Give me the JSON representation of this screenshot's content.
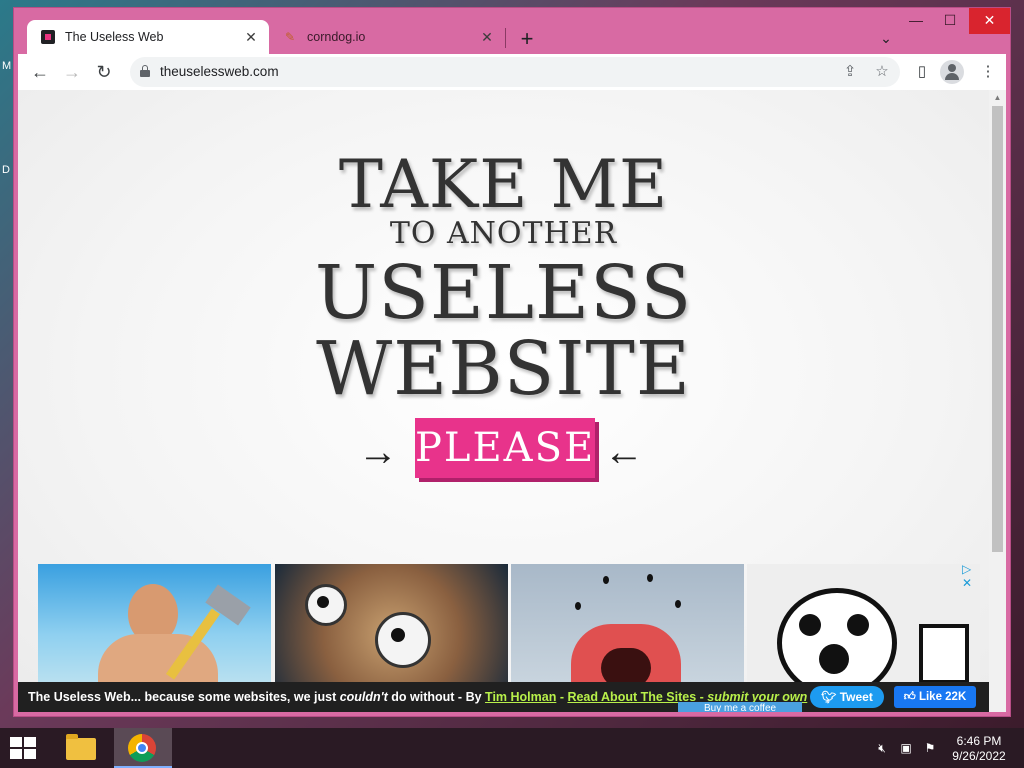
{
  "browser": {
    "tabs": [
      {
        "title": "The Useless Web",
        "active": true
      },
      {
        "title": "corndog.io",
        "active": false
      }
    ],
    "address": "theuselessweb.com",
    "window_controls": {
      "minimize": "—",
      "maximize": "☐",
      "close": "✕"
    }
  },
  "page": {
    "headline": {
      "line1": "TAKE ME",
      "line2": "TO ANOTHER",
      "line3": "USELESS",
      "line4": "WEBSITE"
    },
    "arrow_left": "→",
    "arrow_right": "←",
    "please_button": "PLEASE",
    "footer": {
      "intro": "The Useless Web... because some websites, we just ",
      "emphasis": "couldn't",
      "after": " do without - By ",
      "author": "Tim Holman",
      "dash1": " - ",
      "read_link": "Read About The Sites",
      "dash2": " - ",
      "submit_link": "submit your own",
      "tweet": "Tweet",
      "like": "Like 22K",
      "bmc": "Buy me a coffee"
    }
  },
  "taskbar": {
    "time": "6:46 PM",
    "date": "9/26/2022"
  },
  "colors": {
    "accent_pink": "#e8338b",
    "window_frame": "#d86aa3",
    "link_green": "#b8f04a"
  }
}
